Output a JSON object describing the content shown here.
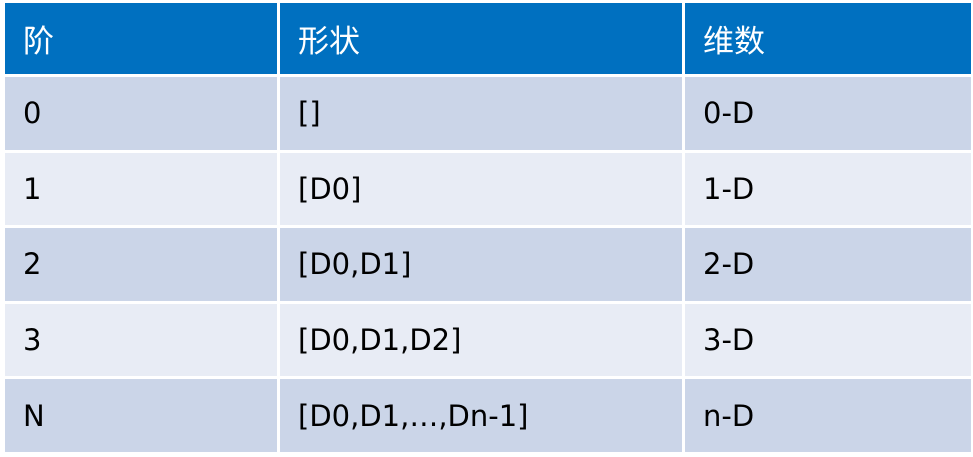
{
  "table": {
    "headers": [
      "阶",
      "形状",
      "维数"
    ],
    "rows": [
      [
        "0",
        "[]",
        "0-D"
      ],
      [
        "1",
        "[D0]",
        "1-D"
      ],
      [
        "2",
        "[D0,D1]",
        "2-D"
      ],
      [
        "3",
        "[D0,D1,D2]",
        "3-D"
      ],
      [
        "N",
        "[D0,D1,…,Dn-1]",
        "n-D"
      ]
    ]
  },
  "colors": {
    "header_bg": "#0070c0",
    "header_text": "#ffffff",
    "row_odd_bg": "#cbd5e8",
    "row_even_bg": "#e8ecf5",
    "border": "#ffffff"
  }
}
